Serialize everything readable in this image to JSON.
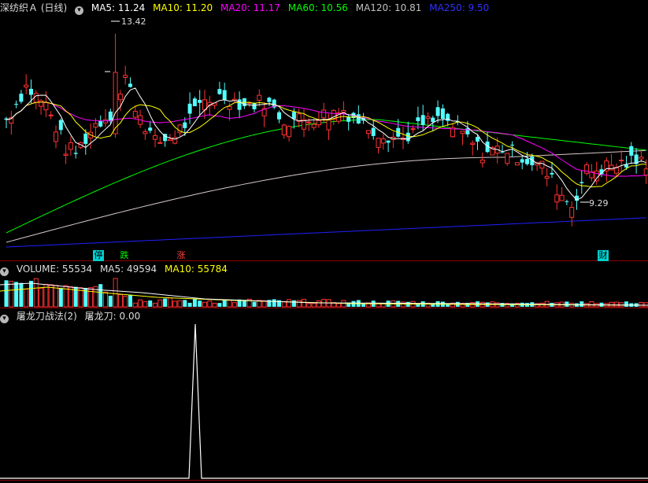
{
  "header": {
    "stock_title": "深纺织Ａ (日线)",
    "ma": [
      {
        "label": "MA5: 11.24",
        "color": "#ffffff"
      },
      {
        "label": "MA10: 11.20",
        "color": "#ffff00"
      },
      {
        "label": "MA20: 11.17",
        "color": "#ff00ff"
      },
      {
        "label": "MA60: 10.56",
        "color": "#00ff00"
      },
      {
        "label": "MA120: 10.81",
        "color": "#c0c0c0"
      },
      {
        "label": "MA250: 9.50",
        "color": "#3030ff"
      }
    ]
  },
  "price_labels": {
    "high": "13.42",
    "low": "9.29"
  },
  "signals": [
    {
      "text": "停",
      "color": "#00ffff"
    },
    {
      "text": "跌",
      "color": "#00ff00"
    },
    {
      "text": "涨",
      "color": "#ff4040"
    },
    {
      "text": "财",
      "color": "#00ffff"
    }
  ],
  "volume_header": {
    "title": "VOLUME: 55534",
    "ma5": "MA5: 49594",
    "ma10": "MA10: 55784"
  },
  "indicator_header": {
    "title": "屠龙刀战法(2)",
    "value": "屠龙刀: 0.00"
  },
  "colors": {
    "up": "#ff3232",
    "down": "#54ffff",
    "grid": "#8b0000"
  }
}
